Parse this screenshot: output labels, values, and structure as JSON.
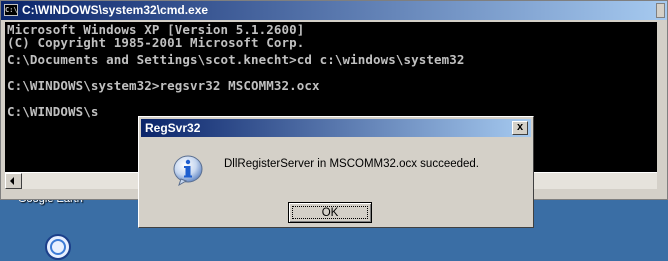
{
  "cmd_window": {
    "title": "C:\\WINDOWS\\system32\\cmd.exe",
    "icon_label": "C:\\",
    "lines": [
      "Microsoft Windows XP [Version 5.1.2600]",
      "(C) Copyright 1985-2001 Microsoft Corp.",
      "",
      "C:\\Documents and Settings\\scot.knecht>cd c:\\windows\\system32",
      "",
      "C:\\WINDOWS\\system32>regsvr32 MSCOMM32.ocx",
      "",
      "C:\\WINDOWS\\s"
    ]
  },
  "desktop": {
    "icon_label": "Google Earth",
    "background": "#3a6ea5"
  },
  "dialog": {
    "title": "RegSvr32",
    "close_label": "x",
    "icon": "info-icon",
    "message": "DllRegisterServer in MSCOMM32.ocx succeeded.",
    "ok_label": "OK"
  },
  "colors": {
    "titlebar_start": "#0a246a",
    "titlebar_end": "#a6caf0",
    "console_bg": "#000000",
    "console_text": "#c0c0c0",
    "info_icon": "#1f5fcf"
  }
}
